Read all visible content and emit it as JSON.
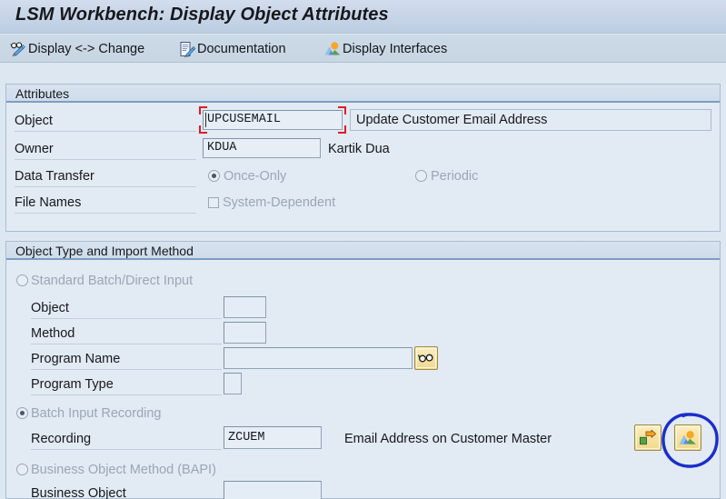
{
  "window": {
    "title": "LSM Workbench: Display Object Attributes"
  },
  "toolbar": {
    "items": [
      {
        "label": "Display <-> Change",
        "icon": "glasses-pencil-icon"
      },
      {
        "label": "Documentation",
        "icon": "document-pencil-icon"
      },
      {
        "label": "Display Interfaces",
        "icon": "landscape-image-icon"
      }
    ]
  },
  "attributes": {
    "header": "Attributes",
    "object": {
      "label": "Object",
      "value": "UPCUSEMAIL",
      "description": "Update Customer Email Address",
      "focused": true
    },
    "owner": {
      "label": "Owner",
      "value": "KDUA",
      "description": "Kartik Dua"
    },
    "data_transfer": {
      "label": "Data Transfer",
      "options": [
        {
          "label": "Once-Only",
          "selected": true
        },
        {
          "label": "Periodic",
          "selected": false
        }
      ]
    },
    "file_names": {
      "label": "File Names",
      "checkbox": {
        "label": "System-Dependent",
        "checked": false
      }
    }
  },
  "object_type": {
    "header": "Object Type and Import Method",
    "standard_batch": {
      "label": "Standard Batch/Direct Input",
      "selected": false,
      "fields": [
        {
          "label": "Object",
          "value": ""
        },
        {
          "label": "Method",
          "value": ""
        },
        {
          "label": "Program Name",
          "value": "",
          "button_icon": "glasses-icon"
        },
        {
          "label": "Program Type",
          "value": ""
        }
      ]
    },
    "batch_input_recording": {
      "label": "Batch Input Recording",
      "selected": true,
      "recording": {
        "label": "Recording",
        "value": "ZCUEM",
        "description": "Email Address on Customer Master"
      },
      "buttons": [
        {
          "icon": "export-arrow-icon",
          "name": "goto-recording-button"
        },
        {
          "icon": "landscape-image-icon",
          "name": "display-recording-button",
          "annotated": true
        }
      ]
    },
    "business_object_method": {
      "label": "Business Object Method  (BAPI)",
      "selected": false,
      "fields": [
        {
          "label": "Business Object",
          "value": ""
        }
      ]
    }
  },
  "annotation": {
    "shape": "hand-drawn-ellipse",
    "color": "#1b2ecb",
    "target": "display-recording-button"
  }
}
